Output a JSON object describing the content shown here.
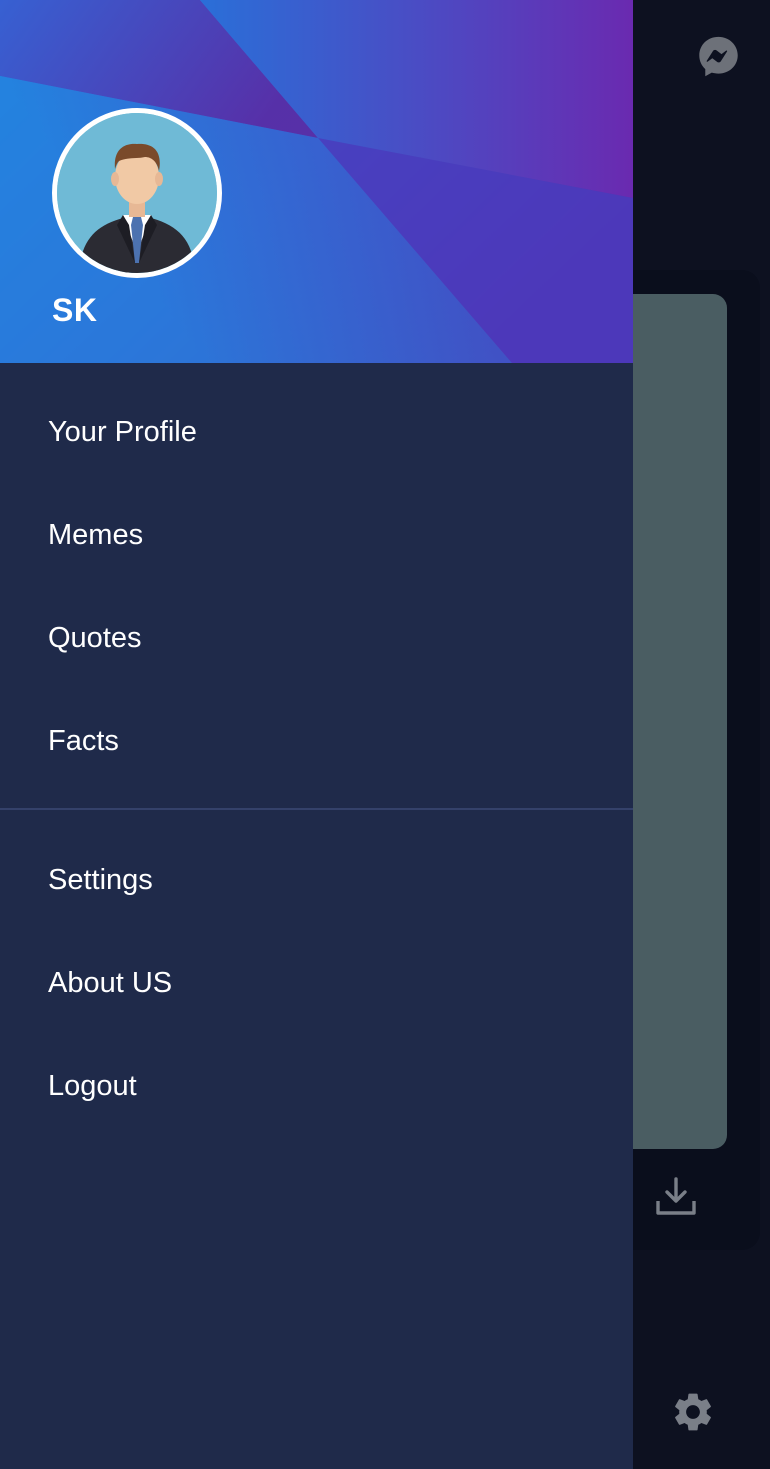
{
  "drawer": {
    "user": {
      "name": "SK",
      "avatar_icon": "businessman-avatar-icon"
    },
    "primary_items": [
      {
        "label": "Your Profile"
      },
      {
        "label": "Memes"
      },
      {
        "label": "Quotes"
      },
      {
        "label": "Facts"
      }
    ],
    "secondary_items": [
      {
        "label": "Settings"
      },
      {
        "label": "About US"
      },
      {
        "label": "Logout"
      }
    ]
  },
  "background_app": {
    "icons": [
      "messenger-icon",
      "download-icon",
      "gear-icon"
    ]
  },
  "colors": {
    "drawer_bg": "#1f2a4a",
    "header_gradient_start": "#1a8fe0",
    "header_gradient_end": "#5a23a0",
    "screen_bg": "#0d1120",
    "card_bg": "#4a5d62",
    "icon_gray": "#7a7f88"
  }
}
